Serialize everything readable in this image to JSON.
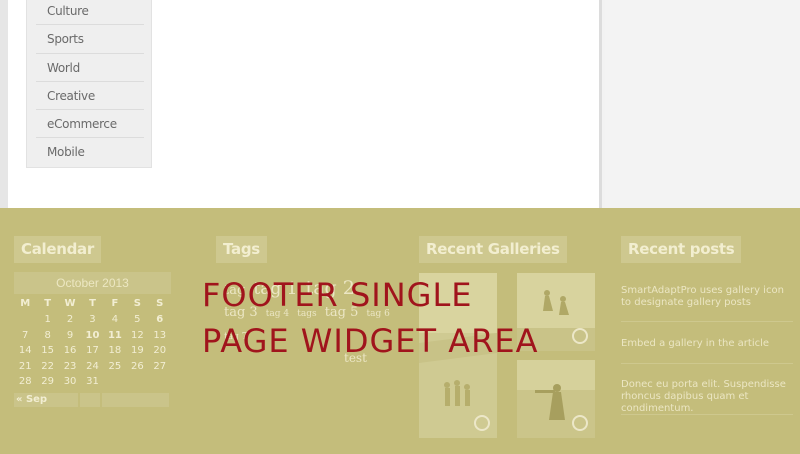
{
  "categories": [
    "Culture",
    "Sports",
    "World",
    "Creative",
    "eCommerce",
    "Mobile"
  ],
  "footer": {
    "calendar": {
      "title": "Calendar",
      "caption": "October 2013",
      "weekdays": [
        "M",
        "T",
        "W",
        "T",
        "F",
        "S",
        "S"
      ],
      "weeks": [
        [
          "",
          "1",
          "2",
          "3",
          "4",
          "5",
          "6"
        ],
        [
          "7",
          "8",
          "9",
          "10",
          "11",
          "12",
          "13"
        ],
        [
          "14",
          "15",
          "16",
          "17",
          "18",
          "19",
          "20"
        ],
        [
          "21",
          "22",
          "23",
          "24",
          "25",
          "26",
          "27"
        ],
        [
          "28",
          "29",
          "30",
          "31",
          "",
          "",
          ""
        ]
      ],
      "prev_label": "« Sep"
    },
    "tags": {
      "title": "Tags",
      "items": [
        "tag",
        "tag 1",
        "tag 2",
        "tag 3",
        "tag 4",
        "tags",
        "tag 5",
        "tag 6",
        "tag 7",
        "test"
      ]
    },
    "galleries": {
      "title": "Recent Galleries"
    },
    "recent_posts": {
      "title": "Recent posts",
      "items": [
        "SmartAdaptPro uses gallery icon to designate gallery posts",
        "Embed a gallery in the article",
        "Donec eu porta elit. Suspendisse rhoncus dapibus quam et condimentum."
      ]
    }
  },
  "overlay": {
    "line1": "FOOTER SINGLE",
    "line2": "PAGE WIDGET AREA"
  },
  "colors": {
    "footer_bg": "#c4bd7b",
    "overlay_text": "#a0141c"
  }
}
